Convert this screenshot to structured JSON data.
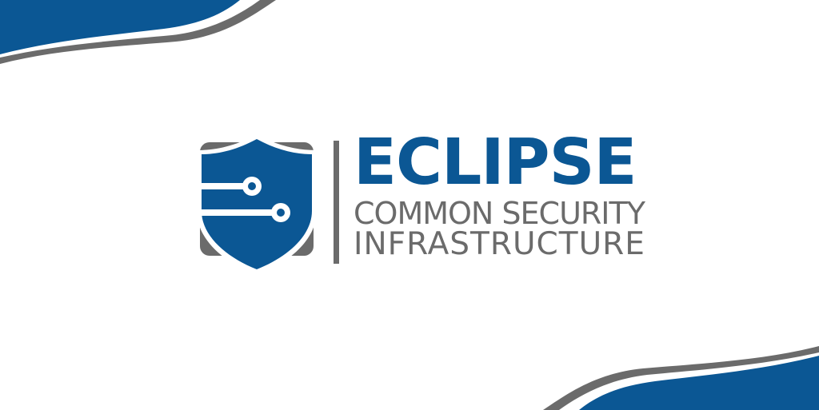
{
  "logo": {
    "name": "ECLIPSE",
    "tagline_line1": "COMMON SECURITY",
    "tagline_line2": "INFRASTRUCTURE",
    "shield_icon": "shield-circuit-icon"
  },
  "colors": {
    "brand_blue": "#0b5794",
    "brand_gray": "#6b6b6b",
    "background": "#ffffff"
  }
}
